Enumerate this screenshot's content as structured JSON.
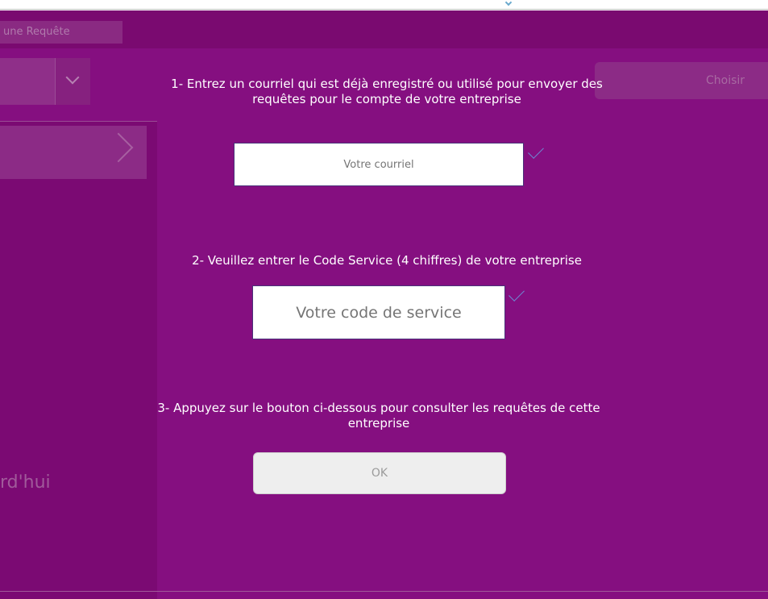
{
  "header": {
    "tab_label": "une Requête"
  },
  "background": {
    "right_button_label": "Choisir",
    "left_today_label": "rd'hui"
  },
  "dialog": {
    "step1_text": "1- Entrez un courriel qui est déjà enregistré ou utilisé pour envoyer des requêtes pour le compte de votre entreprise",
    "email_placeholder": "Votre courriel",
    "step2_text": "2- Veuillez entrer le Code Service (4 chiffres) de votre entreprise",
    "code_placeholder": "Votre code de service",
    "step3_text": "3- Appuyez sur le bouton ci-dessous pour consulter les requêtes de cette entreprise",
    "ok_label": "OK"
  },
  "icons": {
    "field_check": "check-icon",
    "dropdown": "chevron-down-icon",
    "card": "chevron-right-icon"
  },
  "colors": {
    "overlay_purple": "#850f80",
    "header_purple": "#7a0a70",
    "input_border": "#4a327a",
    "check_blue": "#6b8fd6",
    "button_disabled": "#eeeeee"
  }
}
